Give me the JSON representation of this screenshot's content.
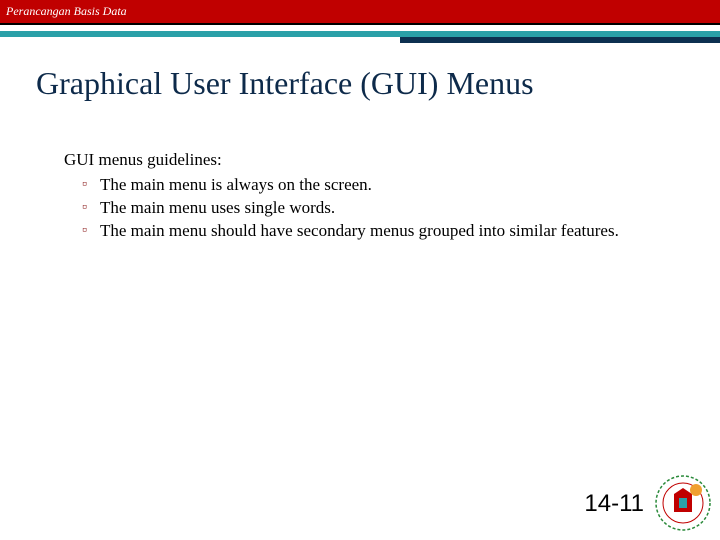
{
  "header": {
    "course": "Perancangan Basis Data"
  },
  "title": "Graphical User Interface (GUI) Menus",
  "content": {
    "subhead": "GUI menus guidelines:",
    "bullets": [
      "The main menu is always on the screen.",
      "The main menu uses single words.",
      "The main menu should have secondary menus grouped into similar features."
    ]
  },
  "page_number": "14-11"
}
